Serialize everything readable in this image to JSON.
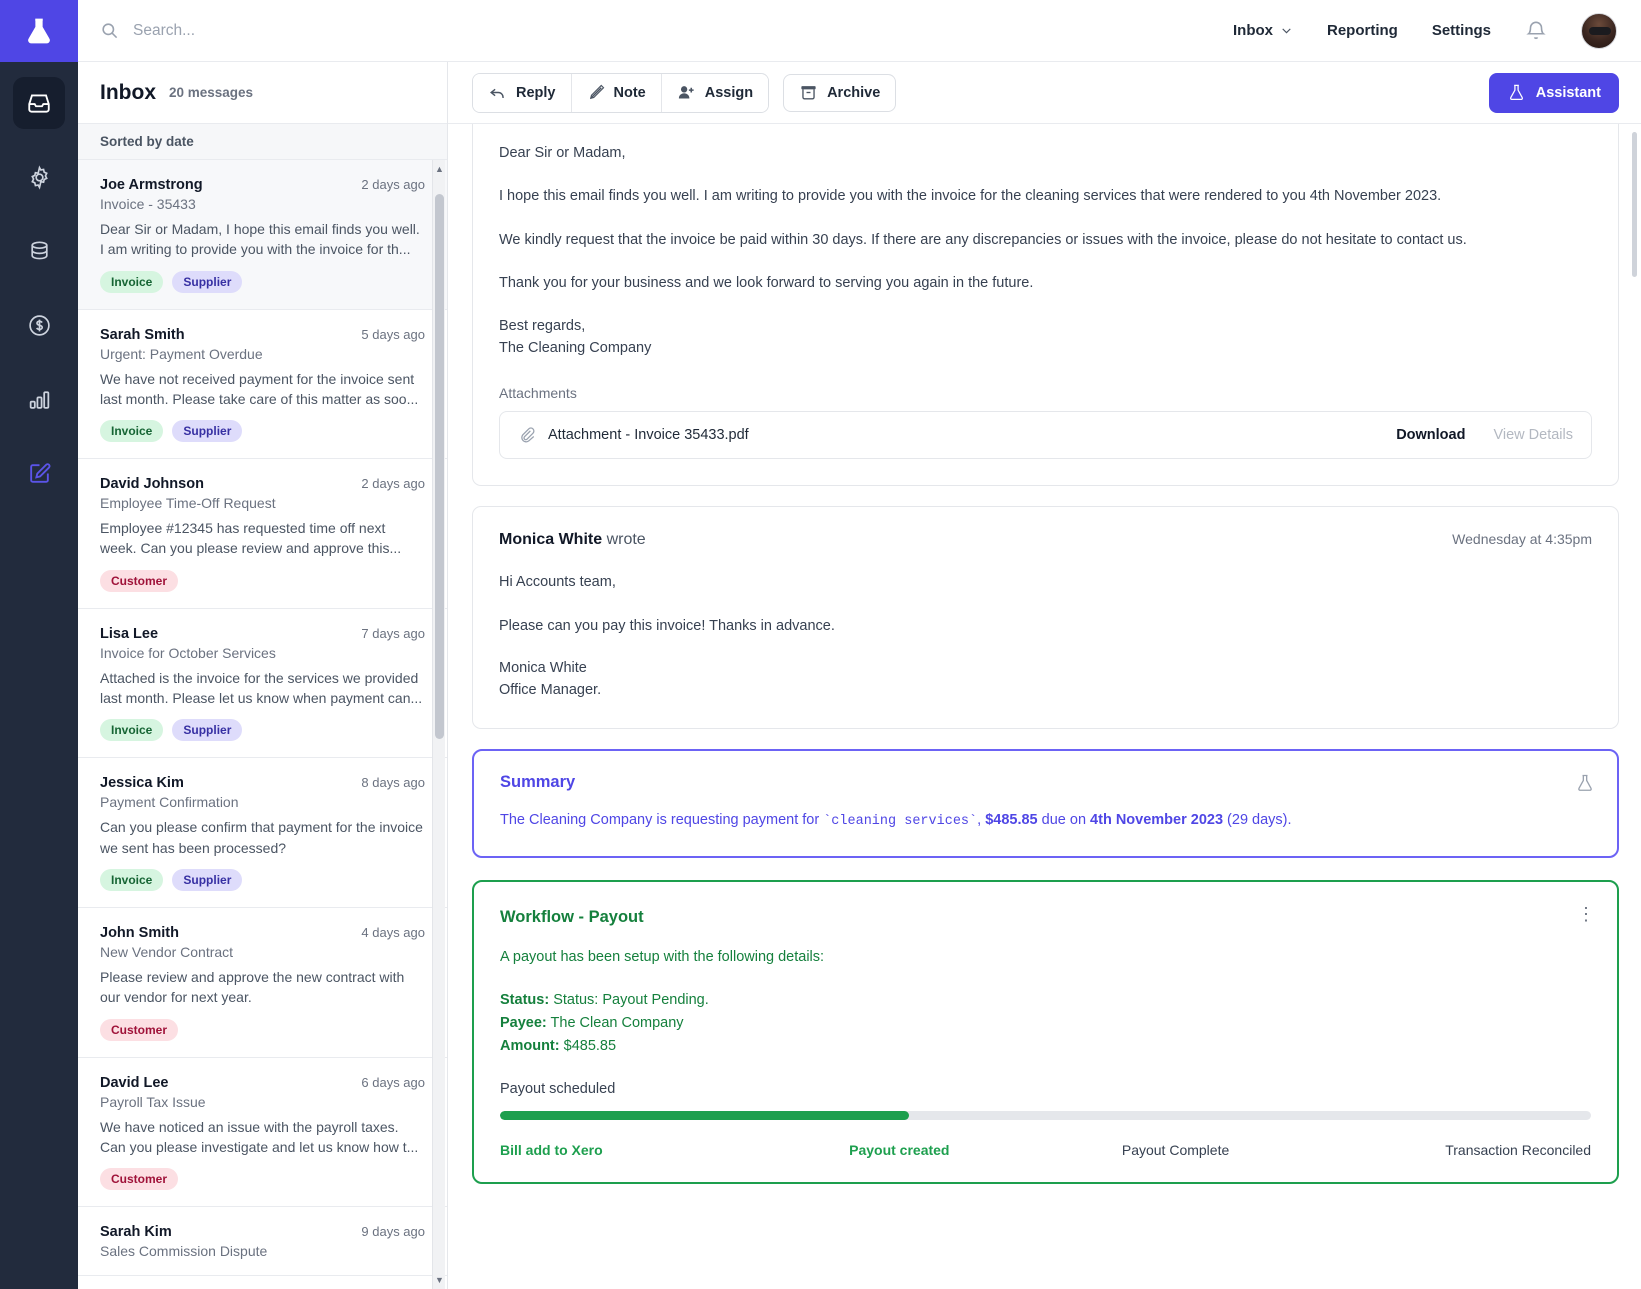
{
  "brand": {
    "logo_icon": "flask-icon",
    "accent": "#4f46e5",
    "rail_bg": "#222b3d"
  },
  "rail": {
    "items": [
      {
        "icon": "inbox-icon",
        "name": "inbox",
        "active": true
      },
      {
        "icon": "gear-icon",
        "name": "settings",
        "active": false
      },
      {
        "icon": "database-icon",
        "name": "data",
        "active": false
      },
      {
        "icon": "dollar-circle-icon",
        "name": "billing",
        "active": false
      },
      {
        "icon": "bar-chart-icon",
        "name": "analytics",
        "active": false
      },
      {
        "icon": "edit-pencil-icon",
        "name": "compose",
        "active": false
      }
    ]
  },
  "search": {
    "placeholder": "Search...",
    "value": "",
    "icon": "search-icon"
  },
  "topnav": {
    "items": [
      {
        "label": "Inbox",
        "has_chevron": true
      },
      {
        "label": "Reporting",
        "has_chevron": false
      },
      {
        "label": "Settings",
        "has_chevron": false
      }
    ],
    "bell_icon": "bell-icon",
    "avatar_icon": "avatar"
  },
  "list": {
    "title": "Inbox",
    "count": "20 messages",
    "sort_label": "Sorted by date",
    "messages": [
      {
        "from": "Joe Armstrong",
        "time": "2 days ago",
        "subject": "Invoice - 35433",
        "preview": "Dear Sir or Madam, I hope this email finds you well. I am writing to provide you with the invoice for th...",
        "tags": [
          "Invoice",
          "Supplier"
        ],
        "selected": true
      },
      {
        "from": "Sarah Smith",
        "time": "5 days ago",
        "subject": "Urgent: Payment Overdue",
        "preview": "We have not received payment for the invoice sent last month. Please take care of this matter as soo...",
        "tags": [
          "Invoice",
          "Supplier"
        ],
        "selected": false
      },
      {
        "from": "David Johnson",
        "time": "2 days ago",
        "subject": "Employee Time-Off Request",
        "preview": "Employee #12345 has requested time off next week. Can you please review and approve this...",
        "tags": [
          "Customer"
        ],
        "selected": false
      },
      {
        "from": "Lisa Lee",
        "time": "7 days ago",
        "subject": "Invoice for October Services",
        "preview": "Attached is the invoice for the services we provided last month. Please let us know when payment can...",
        "tags": [
          "Invoice",
          "Supplier"
        ],
        "selected": false
      },
      {
        "from": "Jessica Kim",
        "time": "8 days ago",
        "subject": "Payment Confirmation",
        "preview": "Can you please confirm that payment for the invoice we sent has been processed?",
        "tags": [
          "Invoice",
          "Supplier"
        ],
        "selected": false
      },
      {
        "from": "John Smith",
        "time": "4 days ago",
        "subject": "New Vendor Contract",
        "preview": "Please review and approve the new contract with our vendor for next year.",
        "tags": [
          "Customer"
        ],
        "selected": false
      },
      {
        "from": "David Lee",
        "time": "6 days ago",
        "subject": "Payroll Tax Issue",
        "preview": "We have noticed an issue with the payroll taxes. Can you please investigate and let us know how t...",
        "tags": [
          "Customer"
        ],
        "selected": false
      },
      {
        "from": "Sarah Kim",
        "time": "9 days ago",
        "subject": "Sales Commission Dispute",
        "preview": "",
        "tags": [],
        "selected": false
      }
    ]
  },
  "actions": {
    "reply": "Reply",
    "note": "Note",
    "assign": "Assign",
    "archive": "Archive",
    "assistant": "Assistant"
  },
  "email": {
    "paragraphs": [
      "Dear Sir or Madam,",
      "I hope this email finds you well. I am writing to provide you with the invoice for the cleaning services that were rendered to you 4th November 2023.",
      "We kindly request that the invoice be paid within 30 days. If there are any discrepancies or issues with the invoice, please do not hesitate to contact us.",
      "Thank you for your business and we look forward to serving you again in the future."
    ],
    "signoff": "Best regards,",
    "signoff_company": "The Cleaning Company",
    "attachments_label": "Attachments",
    "attachment": {
      "icon": "paperclip-icon",
      "name": "Attachment - Invoice 35433.pdf",
      "download_label": "Download",
      "view_details_label": "View Details"
    }
  },
  "note": {
    "author": "Monica White",
    "author_suffix": "wrote",
    "time": "Wednesday at 4:35pm",
    "greeting": "Hi Accounts team,",
    "body": "Please can you pay this invoice! Thanks in advance.",
    "sig_name": "Monica White",
    "sig_role": "Office Manager."
  },
  "summary": {
    "title": "Summary",
    "icon": "flask-icon",
    "prefix": "The Cleaning Company is requesting payment for ",
    "service": "`cleaning services`",
    "comma": ", ",
    "amount": "$485.85",
    "middle": " due on ",
    "due_date": "4th November 2023",
    "suffix": " (29 days)."
  },
  "workflow": {
    "title": "Workflow - Payout",
    "menu_icon": "kebab-menu-icon",
    "intro": "A payout has been setup with the following details:",
    "fields": [
      {
        "key": "Status:",
        "value": "Status: Payout Pending."
      },
      {
        "key": "Payee:",
        "value": "The Clean Company"
      },
      {
        "key": "Amount:",
        "value": "$485.85"
      }
    ],
    "status_text": "Payout scheduled",
    "progress_percent": 37.5,
    "steps": [
      {
        "label": "Bill add to Xero",
        "state": "done"
      },
      {
        "label": "Payout created",
        "state": "done"
      },
      {
        "label": "Payout Complete",
        "state": "todo"
      },
      {
        "label": "Transaction Reconciled",
        "state": "todo"
      }
    ]
  }
}
